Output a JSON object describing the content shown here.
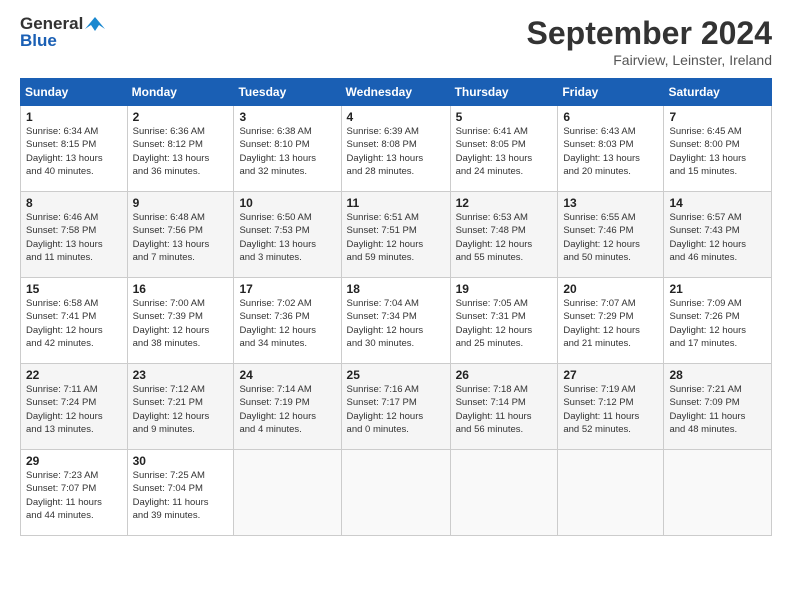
{
  "header": {
    "logo_line1": "General",
    "logo_line2": "Blue",
    "month": "September 2024",
    "location": "Fairview, Leinster, Ireland"
  },
  "weekdays": [
    "Sunday",
    "Monday",
    "Tuesday",
    "Wednesday",
    "Thursday",
    "Friday",
    "Saturday"
  ],
  "weeks": [
    [
      {
        "day": 1,
        "info": "Sunrise: 6:34 AM\nSunset: 8:15 PM\nDaylight: 13 hours\nand 40 minutes."
      },
      {
        "day": 2,
        "info": "Sunrise: 6:36 AM\nSunset: 8:12 PM\nDaylight: 13 hours\nand 36 minutes."
      },
      {
        "day": 3,
        "info": "Sunrise: 6:38 AM\nSunset: 8:10 PM\nDaylight: 13 hours\nand 32 minutes."
      },
      {
        "day": 4,
        "info": "Sunrise: 6:39 AM\nSunset: 8:08 PM\nDaylight: 13 hours\nand 28 minutes."
      },
      {
        "day": 5,
        "info": "Sunrise: 6:41 AM\nSunset: 8:05 PM\nDaylight: 13 hours\nand 24 minutes."
      },
      {
        "day": 6,
        "info": "Sunrise: 6:43 AM\nSunset: 8:03 PM\nDaylight: 13 hours\nand 20 minutes."
      },
      {
        "day": 7,
        "info": "Sunrise: 6:45 AM\nSunset: 8:00 PM\nDaylight: 13 hours\nand 15 minutes."
      }
    ],
    [
      {
        "day": 8,
        "info": "Sunrise: 6:46 AM\nSunset: 7:58 PM\nDaylight: 13 hours\nand 11 minutes."
      },
      {
        "day": 9,
        "info": "Sunrise: 6:48 AM\nSunset: 7:56 PM\nDaylight: 13 hours\nand 7 minutes."
      },
      {
        "day": 10,
        "info": "Sunrise: 6:50 AM\nSunset: 7:53 PM\nDaylight: 13 hours\nand 3 minutes."
      },
      {
        "day": 11,
        "info": "Sunrise: 6:51 AM\nSunset: 7:51 PM\nDaylight: 12 hours\nand 59 minutes."
      },
      {
        "day": 12,
        "info": "Sunrise: 6:53 AM\nSunset: 7:48 PM\nDaylight: 12 hours\nand 55 minutes."
      },
      {
        "day": 13,
        "info": "Sunrise: 6:55 AM\nSunset: 7:46 PM\nDaylight: 12 hours\nand 50 minutes."
      },
      {
        "day": 14,
        "info": "Sunrise: 6:57 AM\nSunset: 7:43 PM\nDaylight: 12 hours\nand 46 minutes."
      }
    ],
    [
      {
        "day": 15,
        "info": "Sunrise: 6:58 AM\nSunset: 7:41 PM\nDaylight: 12 hours\nand 42 minutes."
      },
      {
        "day": 16,
        "info": "Sunrise: 7:00 AM\nSunset: 7:39 PM\nDaylight: 12 hours\nand 38 minutes."
      },
      {
        "day": 17,
        "info": "Sunrise: 7:02 AM\nSunset: 7:36 PM\nDaylight: 12 hours\nand 34 minutes."
      },
      {
        "day": 18,
        "info": "Sunrise: 7:04 AM\nSunset: 7:34 PM\nDaylight: 12 hours\nand 30 minutes."
      },
      {
        "day": 19,
        "info": "Sunrise: 7:05 AM\nSunset: 7:31 PM\nDaylight: 12 hours\nand 25 minutes."
      },
      {
        "day": 20,
        "info": "Sunrise: 7:07 AM\nSunset: 7:29 PM\nDaylight: 12 hours\nand 21 minutes."
      },
      {
        "day": 21,
        "info": "Sunrise: 7:09 AM\nSunset: 7:26 PM\nDaylight: 12 hours\nand 17 minutes."
      }
    ],
    [
      {
        "day": 22,
        "info": "Sunrise: 7:11 AM\nSunset: 7:24 PM\nDaylight: 12 hours\nand 13 minutes."
      },
      {
        "day": 23,
        "info": "Sunrise: 7:12 AM\nSunset: 7:21 PM\nDaylight: 12 hours\nand 9 minutes."
      },
      {
        "day": 24,
        "info": "Sunrise: 7:14 AM\nSunset: 7:19 PM\nDaylight: 12 hours\nand 4 minutes."
      },
      {
        "day": 25,
        "info": "Sunrise: 7:16 AM\nSunset: 7:17 PM\nDaylight: 12 hours\nand 0 minutes."
      },
      {
        "day": 26,
        "info": "Sunrise: 7:18 AM\nSunset: 7:14 PM\nDaylight: 11 hours\nand 56 minutes."
      },
      {
        "day": 27,
        "info": "Sunrise: 7:19 AM\nSunset: 7:12 PM\nDaylight: 11 hours\nand 52 minutes."
      },
      {
        "day": 28,
        "info": "Sunrise: 7:21 AM\nSunset: 7:09 PM\nDaylight: 11 hours\nand 48 minutes."
      }
    ],
    [
      {
        "day": 29,
        "info": "Sunrise: 7:23 AM\nSunset: 7:07 PM\nDaylight: 11 hours\nand 44 minutes."
      },
      {
        "day": 30,
        "info": "Sunrise: 7:25 AM\nSunset: 7:04 PM\nDaylight: 11 hours\nand 39 minutes."
      },
      null,
      null,
      null,
      null,
      null
    ]
  ]
}
